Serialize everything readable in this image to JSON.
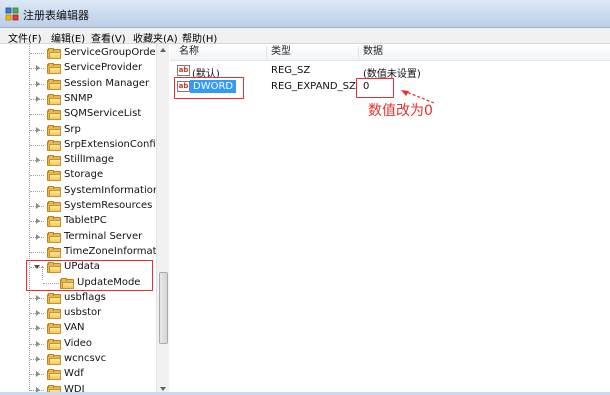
{
  "window": {
    "title": "注册表编辑器",
    "icon": "regedit-icon"
  },
  "menubar": {
    "items": [
      {
        "label": "文件(F)"
      },
      {
        "label": "编辑(E)"
      },
      {
        "label": "查看(V)"
      },
      {
        "label": "收藏夹(A)"
      },
      {
        "label": "帮助(H)"
      }
    ]
  },
  "tree": {
    "items": [
      {
        "label": "ServiceGroupOrder",
        "expander": "none",
        "level": 1
      },
      {
        "label": "ServiceProvider",
        "expander": "collapsed",
        "level": 1
      },
      {
        "label": "Session Manager",
        "expander": "collapsed",
        "level": 1
      },
      {
        "label": "SNMP",
        "expander": "collapsed",
        "level": 1
      },
      {
        "label": "SQMServiceList",
        "expander": "none",
        "level": 1
      },
      {
        "label": "Srp",
        "expander": "collapsed",
        "level": 1
      },
      {
        "label": "SrpExtensionConfig",
        "expander": "none",
        "level": 1
      },
      {
        "label": "StillImage",
        "expander": "collapsed",
        "level": 1
      },
      {
        "label": "Storage",
        "expander": "none",
        "level": 1
      },
      {
        "label": "SystemInformation",
        "expander": "none",
        "level": 1
      },
      {
        "label": "SystemResources",
        "expander": "collapsed",
        "level": 1
      },
      {
        "label": "TabletPC",
        "expander": "collapsed",
        "level": 1
      },
      {
        "label": "Terminal Server",
        "expander": "collapsed",
        "level": 1
      },
      {
        "label": "TimeZoneInformatio",
        "expander": "none",
        "level": 1
      },
      {
        "label": "UPdata",
        "expander": "expanded",
        "level": 1
      },
      {
        "label": "UpdateMode",
        "expander": "none",
        "level": 2
      },
      {
        "label": "usbflags",
        "expander": "collapsed",
        "level": 1
      },
      {
        "label": "usbstor",
        "expander": "collapsed",
        "level": 1
      },
      {
        "label": "VAN",
        "expander": "collapsed",
        "level": 1
      },
      {
        "label": "Video",
        "expander": "collapsed",
        "level": 1
      },
      {
        "label": "wcncsvc",
        "expander": "collapsed",
        "level": 1
      },
      {
        "label": "Wdf",
        "expander": "collapsed",
        "level": 1
      },
      {
        "label": "WDI",
        "expander": "collapsed",
        "level": 1
      }
    ]
  },
  "values": {
    "headers": {
      "name": "名称",
      "type": "类型",
      "data": "数据"
    },
    "rows": [
      {
        "icon": "string-value-icon",
        "icon_text": "ab",
        "name": "(默认)",
        "type": "REG_SZ",
        "data": "(数值未设置)",
        "selected": false
      },
      {
        "icon": "binary-value-icon",
        "icon_text": "ab",
        "name": "DWORD",
        "type": "REG_EXPAND_SZ",
        "data": "0",
        "selected": true
      }
    ]
  },
  "annotation": {
    "text": "数值改为0",
    "color": "#e53030"
  },
  "colors": {
    "selection": "#3399ff",
    "annotation_red": "#e53030",
    "folder": "#e9b94d"
  }
}
